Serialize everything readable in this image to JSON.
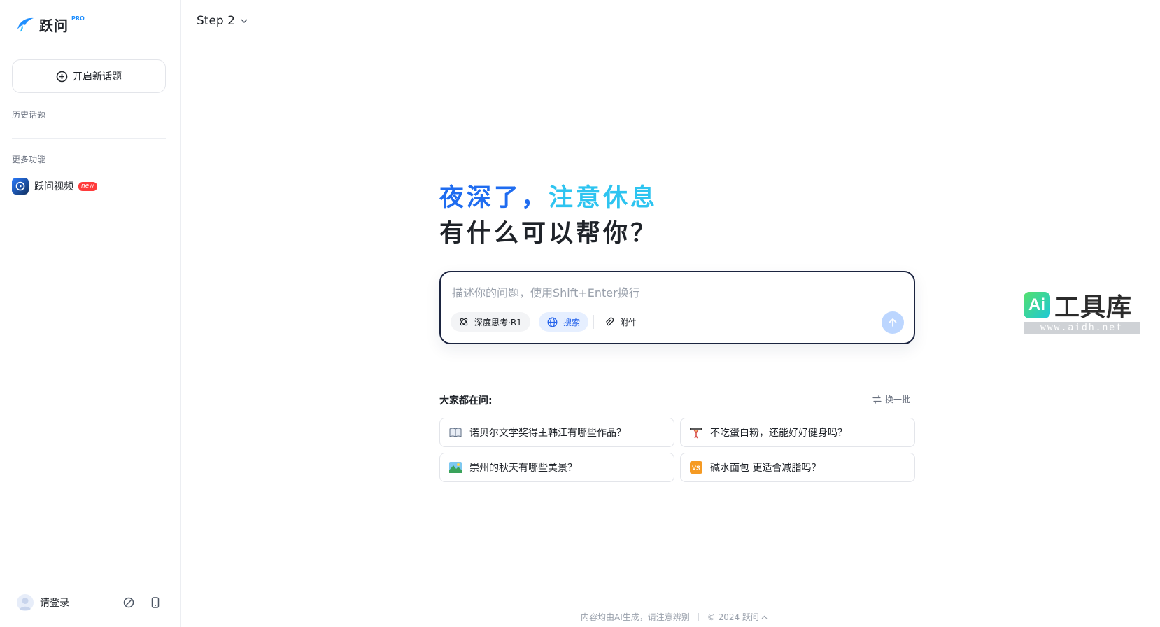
{
  "sidebar": {
    "logo_text": "跃问",
    "logo_badge": "PRO",
    "new_topic_label": "开启新话题",
    "history_label": "历史话题",
    "more_label": "更多功能",
    "video_label": "跃问视频",
    "video_badge": "new",
    "login_label": "请登录"
  },
  "header": {
    "model_name": "Step 2"
  },
  "hero": {
    "greeting_part1": "夜深了，",
    "greeting_part2": "注意休息",
    "question": "有什么可以帮你？"
  },
  "composer": {
    "placeholder": "描述你的问题，使用Shift+Enter换行",
    "deep_think_label": "深度思考·R1",
    "search_label": "搜索",
    "attach_label": "附件"
  },
  "suggestions": {
    "title": "大家都在问:",
    "refresh_label": "换一批",
    "items": [
      {
        "emoji": "book-icon",
        "text": "诺贝尔文学奖得主韩江有哪些作品？"
      },
      {
        "emoji": "weightlifter-icon",
        "text": "不吃蛋白粉，还能好好健身吗？"
      },
      {
        "emoji": "landscape-icon",
        "text": "崇州的秋天有哪些美景？"
      },
      {
        "emoji": "vs-icon",
        "text": "碱水面包 更适合减脂吗？"
      }
    ]
  },
  "footer": {
    "disclaimer": "内容均由AI生成，请注意辨别",
    "copyright": "© 2024 跃问"
  },
  "watermark": {
    "logo": "Ai",
    "name": "工具库",
    "url": "www.aidh.net"
  },
  "colors": {
    "accent_blue": "#1f6cf0",
    "accent_cyan": "#2ec4f0",
    "send_disabled": "#bcd6ff"
  }
}
